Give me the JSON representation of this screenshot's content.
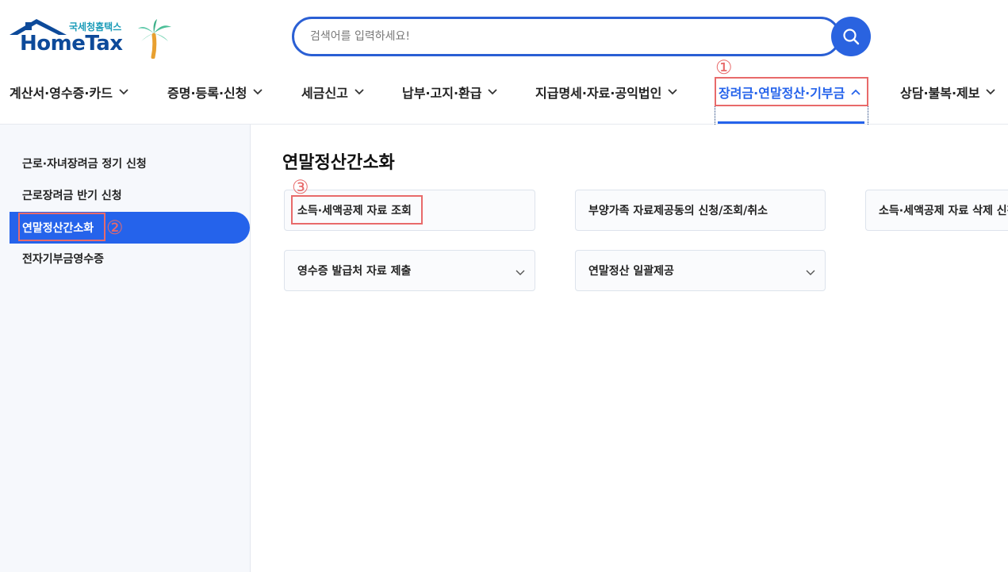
{
  "logo": {
    "sub": "국세청홈택스",
    "main": "HomeTax"
  },
  "search": {
    "placeholder": "검색어를 입력하세요!"
  },
  "gnb": [
    {
      "label": "계산서·영수증·카드"
    },
    {
      "label": "증명·등록·신청"
    },
    {
      "label": "세금신고"
    },
    {
      "label": "납부·고지·환급"
    },
    {
      "label": "지급명세·자료·공익법인"
    },
    {
      "label": "장려금·연말정산·기부금"
    },
    {
      "label": "상담·불복·제보"
    }
  ],
  "annotations": {
    "one": "①",
    "two": "②",
    "three": "③"
  },
  "sidebar": {
    "items": [
      {
        "label": "근로·자녀장려금 정기 신청"
      },
      {
        "label": "근로장려금 반기 신청"
      },
      {
        "label": "연말정산간소화"
      },
      {
        "label": "전자기부금영수증"
      }
    ]
  },
  "main": {
    "title": "연말정산간소화",
    "cards": [
      {
        "label": "소득·세액공제 자료 조회"
      },
      {
        "label": "부양가족 자료제공동의 신청/조회/취소"
      },
      {
        "label": "소득·세액공제 자료 삭제 신청"
      },
      {
        "label": "영수증 발급처 자료 제출"
      },
      {
        "label": "연말정산 일괄제공"
      }
    ]
  },
  "colors": {
    "accent": "#2563eb",
    "brand": "#0d4a9a",
    "annotation": "#e86a6a"
  },
  "icons": {
    "search": "search-icon",
    "chevron_down": "chevron-down-icon",
    "chevron_up": "chevron-up-icon",
    "palm": "palm-tree-icon"
  }
}
